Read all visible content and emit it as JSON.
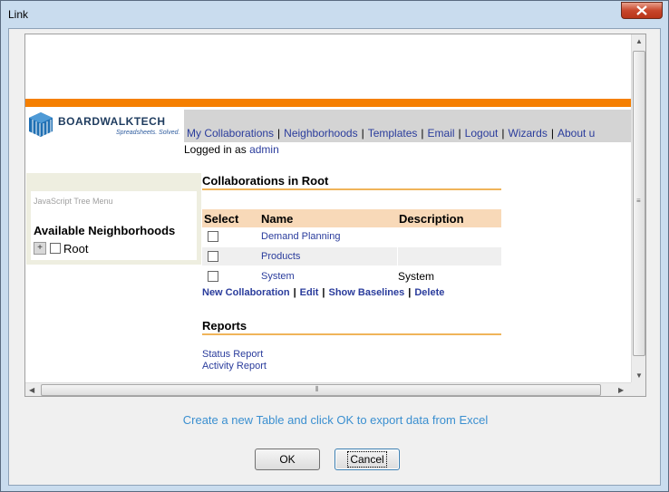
{
  "window": {
    "title": "Link"
  },
  "branding": {
    "logo_text": "BOARDWALKTECH",
    "tagline": "Spreadsheets. Solved."
  },
  "nav": {
    "links": [
      "My Collaborations",
      "Neighborhoods",
      "Templates",
      "Email",
      "Logout",
      "Wizards",
      "About u"
    ],
    "separator": "|"
  },
  "session": {
    "logged_in_label": "Logged in as",
    "user": "admin"
  },
  "sidebar": {
    "tree_title": "JavaScript Tree Menu",
    "heading": "Available Neighborhoods",
    "tree_items": [
      {
        "label": "Root",
        "expand_symbol": "+"
      }
    ]
  },
  "collaborations": {
    "heading": "Collaborations in Root",
    "columns": [
      "Select",
      "Name",
      "Description"
    ],
    "rows": [
      {
        "name": "Demand Planning",
        "description": ""
      },
      {
        "name": "Products",
        "description": ""
      },
      {
        "name": "System",
        "description": "System"
      }
    ],
    "actions": [
      "New Collaboration",
      "Edit",
      "Show Baselines",
      "Delete"
    ]
  },
  "reports": {
    "heading": "Reports",
    "links": [
      "Status Report",
      "Activity Report"
    ]
  },
  "footer": {
    "hint": "Create a new Table and click OK to export data from Excel",
    "ok_label": "OK",
    "cancel_label": "Cancel"
  },
  "colors": {
    "accent_orange": "#f57f00",
    "link_blue": "#2a3c9c",
    "hint_blue": "#3a8fd0",
    "header_peach": "#f8d9b8"
  }
}
